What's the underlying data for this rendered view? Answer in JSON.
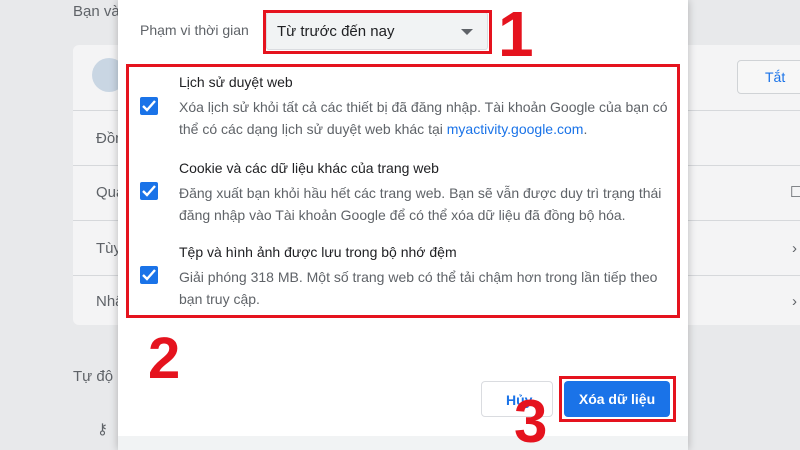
{
  "background": {
    "section1_title": "Bạn và",
    "row_labels": [
      "Đồn",
      "Quả",
      "Tùy",
      "Nhậ"
    ],
    "section2_title": "Tự độ",
    "side_button": "Tắt"
  },
  "dialog": {
    "range_label": "Phạm vi thời gian",
    "range_value": "Từ trước đến nay",
    "options": [
      {
        "title": "Lịch sử duyệt web",
        "desc_before": "Xóa lịch sử khỏi tất cả các thiết bị đã đăng nhập. Tài khoản Google của bạn có thể có các dạng lịch sử duyệt web khác tại",
        "link": "myactivity.google.com",
        "desc_after": ".",
        "checked": true
      },
      {
        "title": "Cookie và các dữ liệu khác của trang web",
        "desc": "Đăng xuất bạn khỏi hầu hết các trang web. Bạn sẽ vẫn được duy trì trạng thái đăng nhập vào Tài khoản Google để có thể xóa dữ liệu đã đồng bộ hóa.",
        "checked": true
      },
      {
        "title": "Tệp và hình ảnh được lưu trong bộ nhớ đệm",
        "desc": "Giải phóng 318 MB. Một số trang web có thể tải chậm hơn trong lần tiếp theo bạn truy cập.",
        "checked": true
      }
    ],
    "cancel_label": "Hủy",
    "clear_label": "Xóa dữ liệu"
  },
  "annotations": {
    "step1": "1",
    "step2": "2",
    "step3": "3",
    "color": "#e5131e"
  },
  "colors": {
    "accent": "#1a73e8",
    "annotation_red": "#e5131e"
  }
}
